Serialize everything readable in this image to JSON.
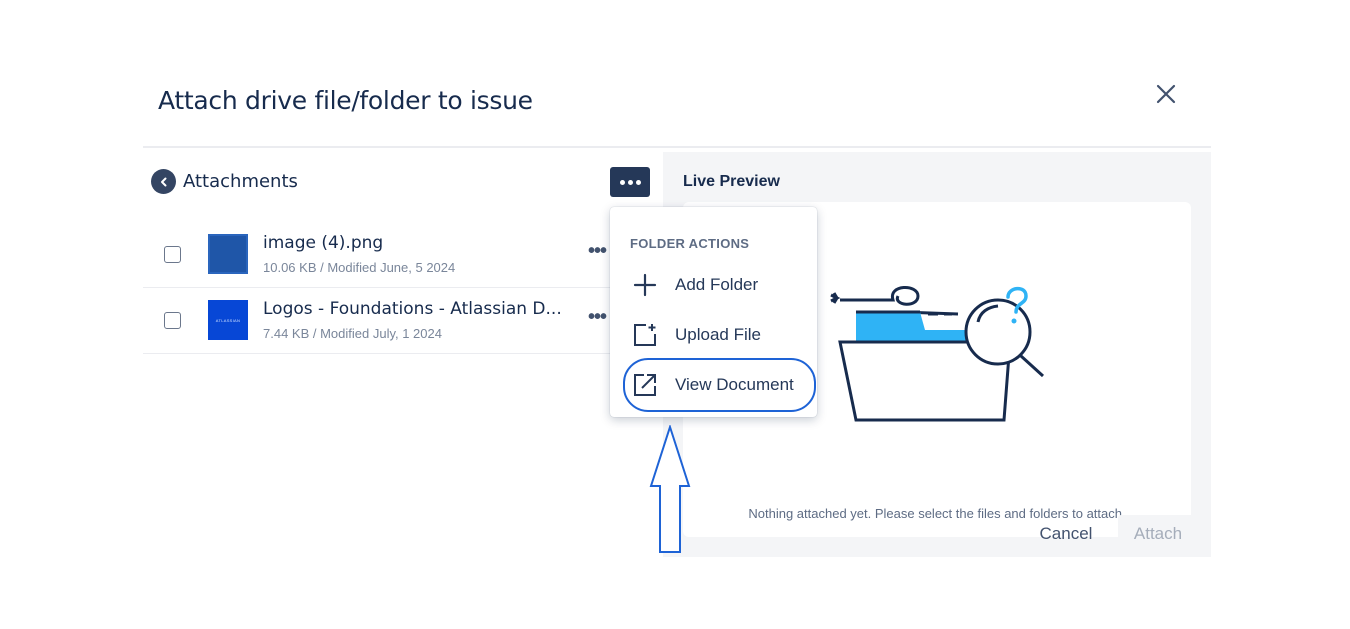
{
  "dialog": {
    "title": "Attach drive file/folder to issue",
    "close_icon": "close-icon"
  },
  "left_panel": {
    "back_label": "Attachments",
    "files": [
      {
        "name": "image (4).png",
        "meta": "10.06 KB / Modified June, 5 2024",
        "checked": false
      },
      {
        "name": "Logos - Foundations - Atlassian D...",
        "meta": "7.44 KB / Modified July, 1 2024",
        "checked": false,
        "thumb_text": "ATLASSIAN"
      }
    ]
  },
  "dropdown": {
    "heading": "FOLDER ACTIONS",
    "items": [
      {
        "label": "Add Folder",
        "icon": "plus-icon"
      },
      {
        "label": "Upload File",
        "icon": "upload-file-icon"
      },
      {
        "label": "View Document",
        "icon": "external-link-icon",
        "highlighted": true
      }
    ]
  },
  "preview": {
    "title": "Live Preview",
    "empty_text": "Nothing attached yet. Please select the files and folders to attach."
  },
  "footer": {
    "cancel_label": "Cancel",
    "attach_label": "Attach",
    "attach_disabled": true
  },
  "colors": {
    "primary_dark": "#253858",
    "highlight": "#1e63d6",
    "illustration_blue": "#2fb3f5",
    "text": "#172b4d"
  }
}
